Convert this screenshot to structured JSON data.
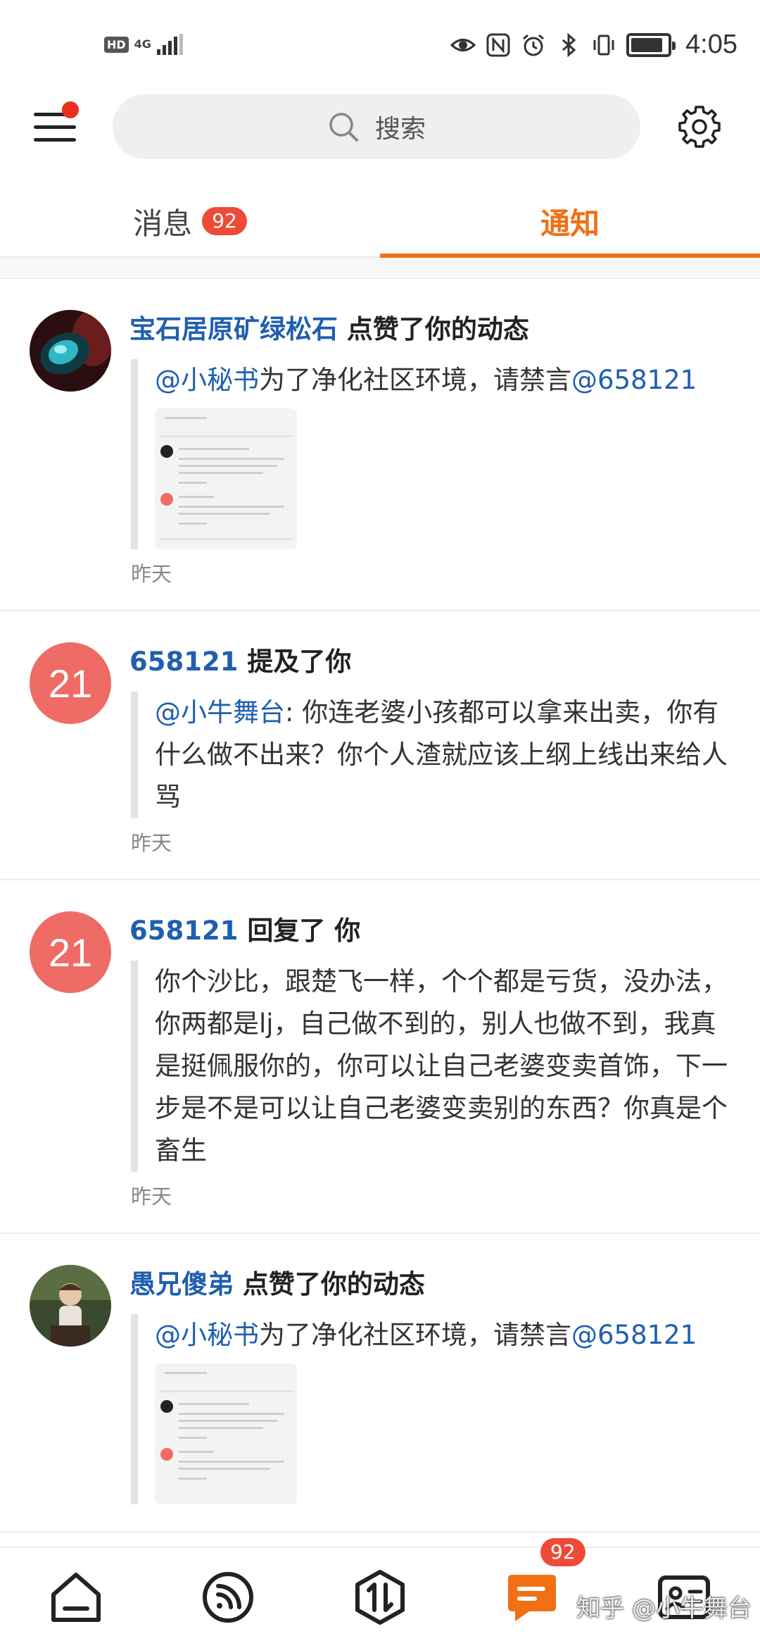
{
  "status_bar": {
    "left_badge": "HD",
    "network": "4G",
    "time": "4:05"
  },
  "search": {
    "placeholder": "搜索"
  },
  "tabs": [
    {
      "label": "消息",
      "badge": "92",
      "active": false
    },
    {
      "label": "通知",
      "active": true
    }
  ],
  "notifications": [
    {
      "user": "宝石居原矿绿松石",
      "action": "点赞了你的动态",
      "mention1": "@小秘书",
      "text": "为了净化社区环境，请禁言",
      "mention2": "@658121",
      "has_thumbnail": true,
      "time": "昨天"
    },
    {
      "user": "658121",
      "action": "提及了你",
      "avatar_text": "21",
      "mention1": "@小牛舞台",
      "text": ": 你连老婆小孩都可以拿来出卖，你有什么做不出来？你个人渣就应该上纲上线出来给人骂",
      "time": "昨天"
    },
    {
      "user": "658121",
      "action": "回复了 你",
      "avatar_text": "21",
      "text": "你个沙比，跟楚飞一样，个个都是亏货，没办法，你两都是lj，自己做不到的，别人也做不到，我真是挺佩服你的，你可以让自己老婆变卖首饰，下一步是不是可以让自己老婆变卖别的东西？你真是个畜生",
      "time": "昨天"
    },
    {
      "user": "愚兄傻弟",
      "action": "点赞了你的动态",
      "mention1": "@小秘书",
      "text": "为了净化社区环境，请禁言",
      "mention2": "@658121",
      "has_thumbnail": true
    }
  ],
  "bottom_nav": {
    "items": [
      "home-icon",
      "feed-icon",
      "exchange-icon",
      "message-icon",
      "profile-card-icon"
    ],
    "message_badge": "92",
    "watermark": "知乎 @小牛舞台"
  },
  "colors": {
    "accent": "#f36f14",
    "link": "#1f5fb0",
    "badge": "#ef4a38",
    "avatar_red": "#ef6b66"
  }
}
